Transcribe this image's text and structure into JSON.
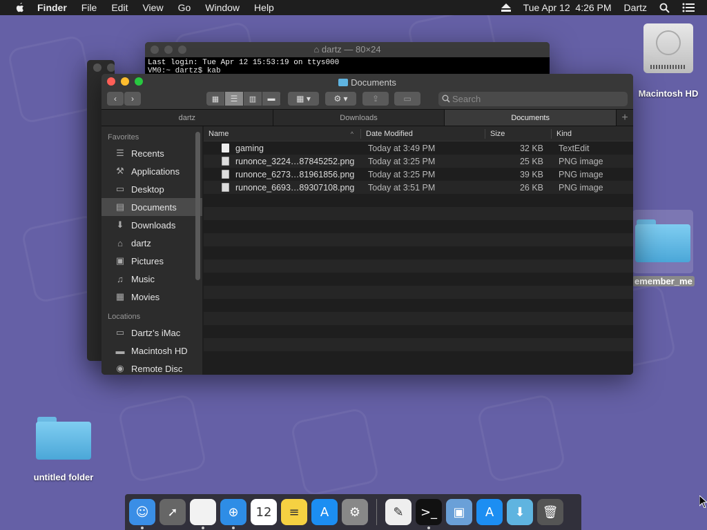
{
  "menubar": {
    "app_name": "Finder",
    "items": [
      "File",
      "Edit",
      "View",
      "Go",
      "Window",
      "Help"
    ],
    "clock": "Tue Apr 12  4:26 PM",
    "user": "Dartz",
    "icons": [
      "apple-icon",
      "eject-icon",
      "spotlight-icon",
      "notification-center-icon"
    ]
  },
  "desktop": {
    "drive_label": "Macintosh HD",
    "folder_right_label": "emember_me",
    "folder_left_label": "untitled folder"
  },
  "terminal": {
    "title": "dartz — 80×24",
    "line1": "Last login: Tue Apr 12 15:53:19 on ttys000",
    "line2": "VM0:~ dartz$ kab"
  },
  "finder": {
    "title": "Documents",
    "search_placeholder": "Search",
    "tabs": [
      {
        "label": "dartz",
        "active": false
      },
      {
        "label": "Downloads",
        "active": false
      },
      {
        "label": "Documents",
        "active": true
      }
    ],
    "sidebar": {
      "favorites_label": "Favorites",
      "favorites": [
        {
          "label": "Recents",
          "icon": "recents-icon",
          "glyph": "☰"
        },
        {
          "label": "Applications",
          "icon": "applications-icon",
          "glyph": "⚒"
        },
        {
          "label": "Desktop",
          "icon": "desktop-icon",
          "glyph": "▭"
        },
        {
          "label": "Documents",
          "icon": "documents-icon",
          "glyph": "▤",
          "selected": true
        },
        {
          "label": "Downloads",
          "icon": "downloads-icon",
          "glyph": "⬇"
        },
        {
          "label": "dartz",
          "icon": "home-icon",
          "glyph": "⌂"
        },
        {
          "label": "Pictures",
          "icon": "pictures-icon",
          "glyph": "▣"
        },
        {
          "label": "Music",
          "icon": "music-icon",
          "glyph": "♫"
        },
        {
          "label": "Movies",
          "icon": "movies-icon",
          "glyph": "▦"
        }
      ],
      "locations_label": "Locations",
      "locations": [
        {
          "label": "Dartz’s iMac",
          "icon": "computer-icon",
          "glyph": "▭"
        },
        {
          "label": "Macintosh HD",
          "icon": "drive-icon",
          "glyph": "▬"
        },
        {
          "label": "Remote Disc",
          "icon": "disc-icon",
          "glyph": "◉"
        }
      ]
    },
    "columns": {
      "name": "Name",
      "date": "Date Modified",
      "size": "Size",
      "kind": "Kind"
    },
    "files": [
      {
        "name": "gaming",
        "date": "Today at 3:49 PM",
        "size": "32 KB",
        "kind": "TextEdit",
        "type": "doc"
      },
      {
        "name": "runonce_3224…87845252.png",
        "date": "Today at 3:25 PM",
        "size": "25 KB",
        "kind": "PNG image",
        "type": "png"
      },
      {
        "name": "runonce_6273…81961856.png",
        "date": "Today at 3:25 PM",
        "size": "39 KB",
        "kind": "PNG image",
        "type": "png"
      },
      {
        "name": "runonce_6693…89307108.png",
        "date": "Today at 3:51 PM",
        "size": "26 KB",
        "kind": "PNG image",
        "type": "png"
      }
    ]
  },
  "dock": {
    "apps": [
      {
        "name": "finder-icon",
        "color": "#3a8ee6",
        "glyph": "☺",
        "running": true
      },
      {
        "name": "launchpad-icon",
        "color": "#666666",
        "glyph": "➚",
        "running": false
      },
      {
        "name": "textedit-doc-icon",
        "color": "#f2f2f2",
        "glyph": "",
        "running": true
      },
      {
        "name": "safari-icon",
        "color": "#2e8de6",
        "glyph": "⊕",
        "running": true
      },
      {
        "name": "calendar-icon",
        "color": "#ffffff",
        "glyph": "12",
        "running": false
      },
      {
        "name": "notes-icon",
        "color": "#f5d142",
        "glyph": "≡",
        "running": false
      },
      {
        "name": "app-store-icon",
        "color": "#1c8ef2",
        "glyph": "A",
        "running": false
      },
      {
        "name": "system-preferences-icon",
        "color": "#888888",
        "glyph": "⚙",
        "running": false
      }
    ],
    "apps_right": [
      {
        "name": "textedit-icon",
        "color": "#eeeeee",
        "glyph": "✎",
        "running": false
      },
      {
        "name": "terminal-icon",
        "color": "#111111",
        "glyph": ">_",
        "running": true
      },
      {
        "name": "preview-icon",
        "color": "#6aa0d8",
        "glyph": "▣",
        "running": false
      },
      {
        "name": "app-store-folder-icon",
        "color": "#1c8ef2",
        "glyph": "A",
        "running": false
      },
      {
        "name": "downloads-stack-icon",
        "color": "#5fb4e0",
        "glyph": "⬇",
        "running": false
      },
      {
        "name": "trash-icon",
        "color": "#555555",
        "glyph": "🗑",
        "running": false
      }
    ]
  }
}
